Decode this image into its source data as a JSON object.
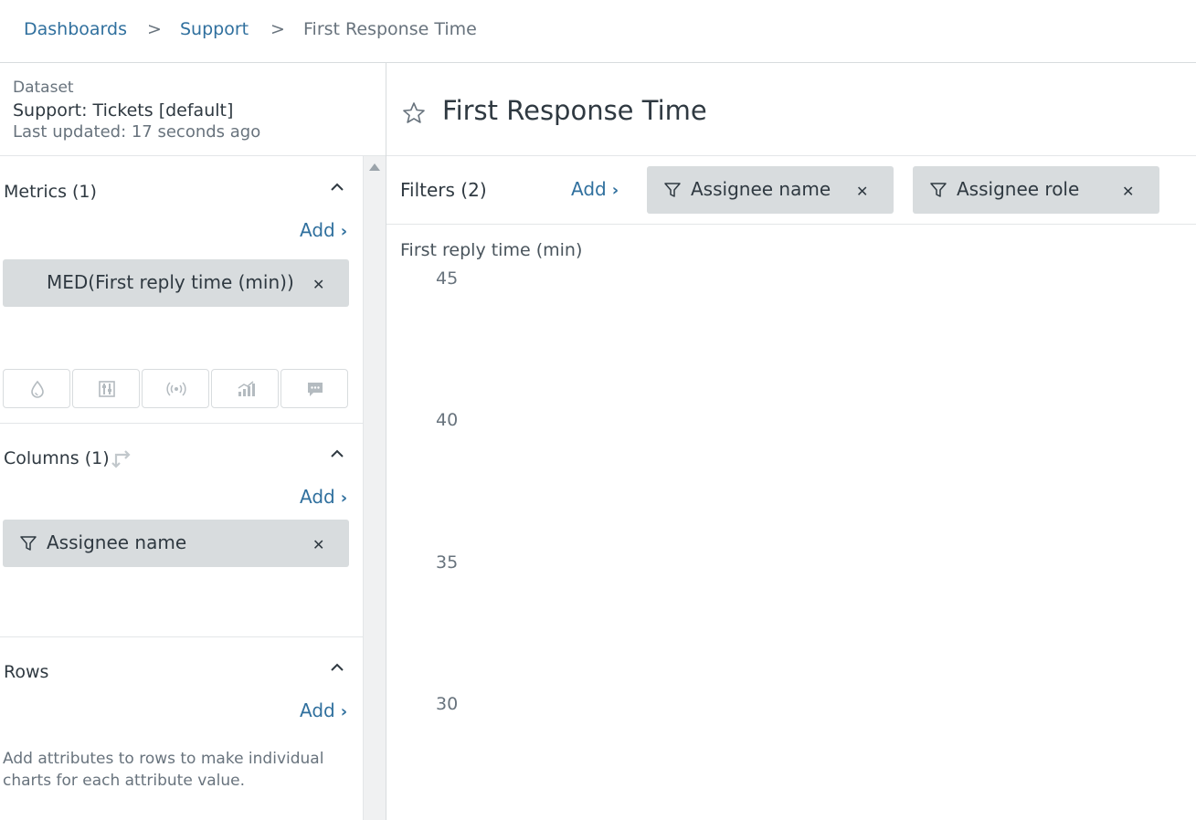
{
  "breadcrumb": {
    "items": [
      "Dashboards",
      "Support",
      "First Response Time"
    ],
    "separator": ">"
  },
  "dataset": {
    "label": "Dataset",
    "name": "Support: Tickets [default]",
    "updated": "Last updated: 17 seconds ago"
  },
  "metrics": {
    "title": "Metrics (1)",
    "add": "Add",
    "items": [
      {
        "label": "MED(First reply time (min))"
      }
    ],
    "toolbar_icons": [
      "drop-icon",
      "sliders-icon",
      "broadcast-icon",
      "chart-growth-icon",
      "comment-icon"
    ]
  },
  "columns": {
    "title": "Columns (1)",
    "add": "Add",
    "items": [
      {
        "label": "Assignee name"
      }
    ]
  },
  "rows": {
    "title": "Rows",
    "add": "Add",
    "help": "Add attributes to rows to make individual charts for each attribute value."
  },
  "report": {
    "title": "First Response Time"
  },
  "filters": {
    "label": "Filters (2)",
    "add": "Add",
    "items": [
      {
        "label": "Assignee name"
      },
      {
        "label": "Assignee role"
      }
    ]
  },
  "chart_data": {
    "type": "bar",
    "ylabel": "First reply time (min)",
    "yticks": [
      45,
      40,
      35,
      30
    ],
    "categories": [],
    "values": []
  },
  "colors": {
    "link": "#30709e",
    "pill": "#d8dcde",
    "text": "#2f3941",
    "muted": "#68737d"
  }
}
